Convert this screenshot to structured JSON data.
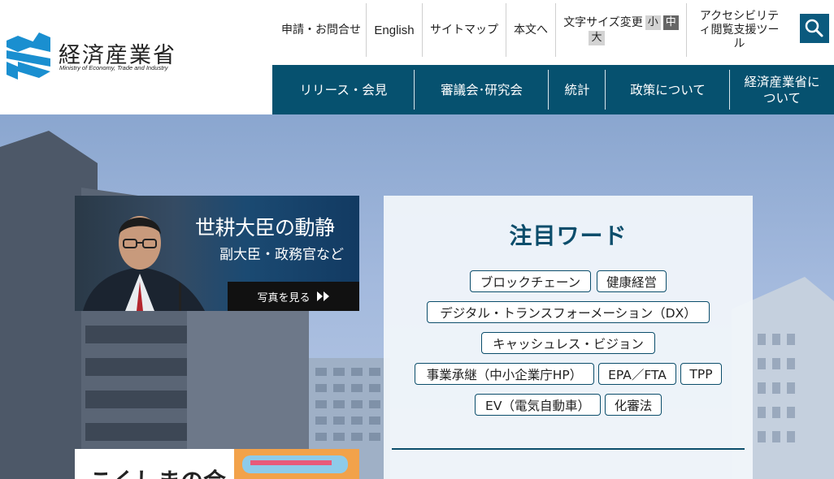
{
  "header": {
    "logo_jp": "経済産業省",
    "logo_en": "Ministry of Economy, Trade and Industry",
    "utility": {
      "apply_contact": "申請・お問合せ",
      "english": "English",
      "sitemap": "サイトマップ",
      "skip_to_content": "本文へ",
      "font_size_label": "文字サイズ変更",
      "font_size_small": "小",
      "font_size_medium": "中",
      "font_size_large": "大",
      "accessibility": "アクセシビリティ閲覧支援ツール"
    },
    "search_icon": "search-icon"
  },
  "nav": {
    "items": [
      {
        "label": "リリース・会見"
      },
      {
        "label": "審議会･研究会"
      },
      {
        "label": "統計"
      },
      {
        "label": "政策について"
      },
      {
        "label": "経済産業省について"
      }
    ]
  },
  "banner": {
    "title": "世耕大臣の動静",
    "subtitle": "副大臣・政務官など",
    "button": "写真を見る"
  },
  "keywords": {
    "title": "注目ワード",
    "items": [
      "ブロックチェーン",
      "健康経営",
      "デジタル・トランスフォーメーション（DX）",
      "キャッシュレス・ビジョン",
      "事業承継（中小企業庁HP）",
      "EPA／FTA",
      "TPP",
      "EV（電気自動車）",
      "化審法"
    ]
  },
  "banner2": {
    "text": "こくしまの会"
  },
  "colors": {
    "nav_bg": "#06516f",
    "accent": "#0b4d6b",
    "logo_blue": "#1a8fd0"
  }
}
